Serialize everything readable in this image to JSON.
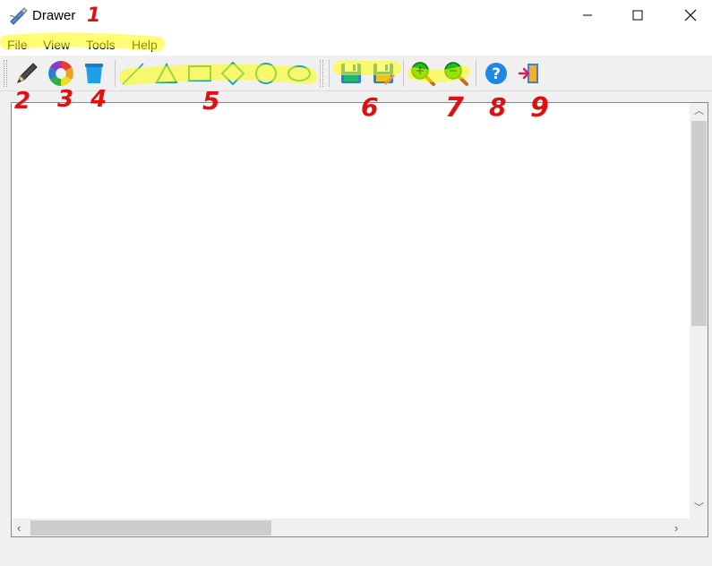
{
  "window": {
    "title": "Drawer",
    "app_icon": "pen-tool-icon",
    "controls": [
      "minimize-icon",
      "maximize-icon",
      "close-icon"
    ]
  },
  "menu": {
    "items": [
      "File",
      "View",
      "Tools",
      "Help"
    ]
  },
  "toolbar": {
    "groups": [
      {
        "tools": [
          "pencil-icon",
          "color-wheel-icon",
          "bucket-icon"
        ]
      },
      {
        "tools": [
          "line-icon",
          "triangle-icon",
          "rectangle-icon",
          "diamond-icon",
          "circle-icon",
          "ellipse-icon"
        ]
      },
      {
        "tools": [
          "save-icon",
          "save-as-icon"
        ]
      },
      {
        "tools": [
          "zoom-in-icon",
          "zoom-out-icon"
        ]
      },
      {
        "tools": [
          "help-icon",
          "exit-icon"
        ]
      }
    ]
  },
  "annotations": {
    "labels": [
      "1",
      "2",
      "3",
      "4",
      "5",
      "6",
      "7",
      "8",
      "9"
    ],
    "highlight_color": "#ffff00",
    "number_color": "#e01010"
  },
  "colors": {
    "shape_stroke": "#1aa89a",
    "save_blue": "#2a7fd0",
    "zoom_green": "#18c018",
    "help_blue": "#1e88e5"
  }
}
